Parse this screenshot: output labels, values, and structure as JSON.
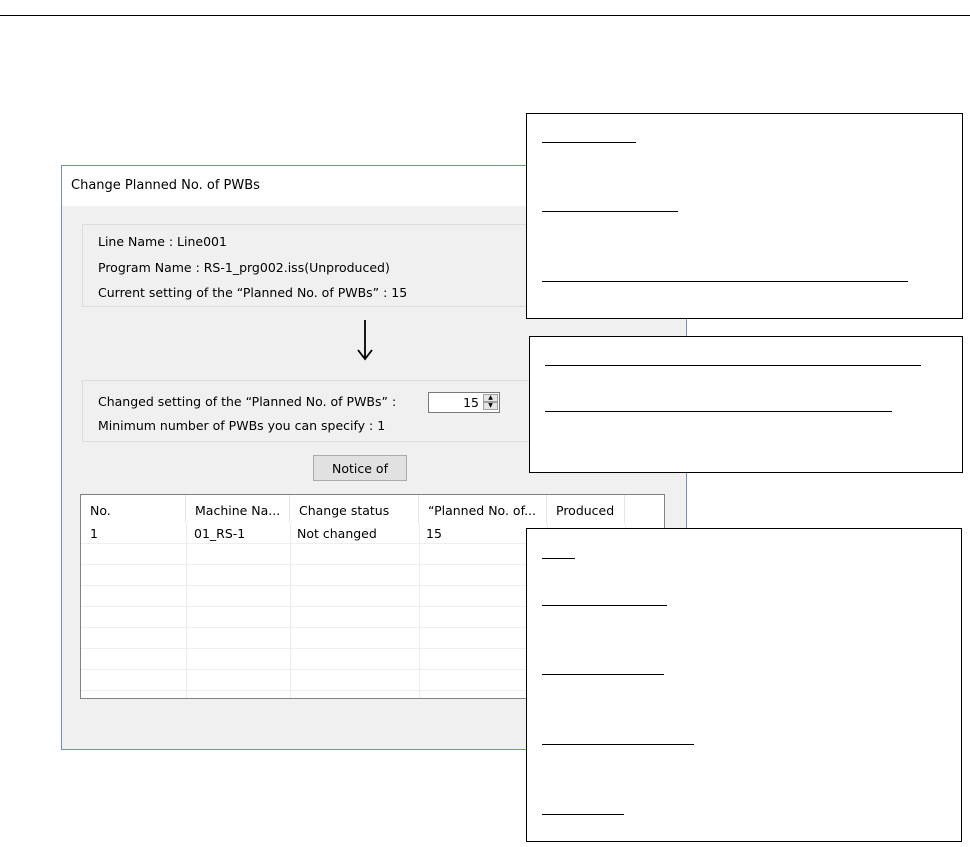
{
  "dialog": {
    "title": "Change Planned No. of PWBs",
    "line_name": "Line Name : Line001",
    "program_name": "Program Name : RS-1_prg002.iss(Unproduced)",
    "current_setting": "Current setting of the “Planned No. of PWBs” : 15",
    "changed_setting_label": "Changed setting of the “Planned No. of PWBs”  :",
    "changed_setting_value": "15",
    "minimum_label": "Minimum number of PWBs you can specify  : 1",
    "notice_button": "Notice of",
    "table": {
      "headers": [
        "No.",
        "Machine Na...",
        "Change status",
        "“Planned No. of...",
        "Produced"
      ],
      "rows": [
        [
          "1",
          "01_RS-1",
          "Not changed",
          "15",
          ""
        ]
      ]
    }
  },
  "icons": {
    "arrow": "arrow-down-icon",
    "spin_up": "spin-up-icon",
    "spin_down": "spin-down-icon"
  }
}
